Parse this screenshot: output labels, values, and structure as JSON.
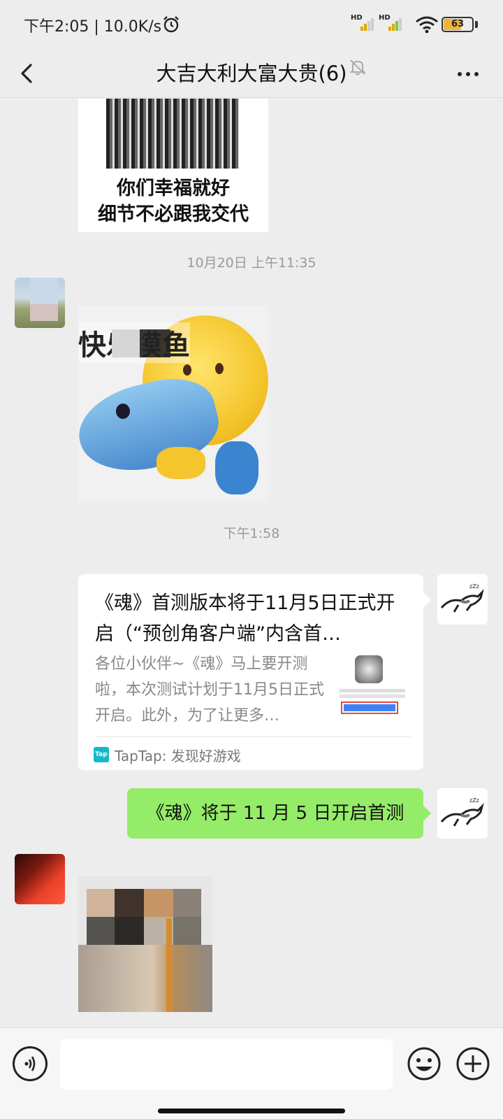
{
  "status_bar": {
    "time": "下午2:05 | 10.0K/s",
    "signal1_label": "HD",
    "signal2_label": "HD",
    "battery_level": "63",
    "battery_fraction": 0.63
  },
  "nav": {
    "title": "大吉大利大富大贵(6)",
    "back_icon": "chevron-left-icon",
    "mute_icon": "bell-muted-icon",
    "more_icon": "more-horizontal-icon"
  },
  "messages": {
    "sticker1_caption_line1": "你们幸福就好",
    "sticker1_caption_line2": "细节不必跟我交代",
    "timestamp1": "10月20日 上午11:35",
    "sticker2_caption": "快乐摸鱼",
    "timestamp2": "下午1:58",
    "link_card": {
      "title": "《魂》首测版本将于11月5日正式开启（“预创角客户端”内含首…",
      "description": "各位小伙伴~《魂》马上要开测啦，本次测试计划于11月5日正式开启。此外，为了让更多…",
      "source_icon_text": "Tap",
      "source": "TapTap: 发现好游戏"
    },
    "outgoing_text": "《魂》将于 11 月 5 日开启首测"
  },
  "input_bar": {
    "voice_icon": "voice-icon",
    "input_value": "",
    "emoji_icon": "emoji-icon",
    "plus_icon": "plus-circle-icon"
  },
  "colors": {
    "background": "#ededed",
    "outgoing_bubble": "#95ec69",
    "incoming_bubble": "#ffffff",
    "battery": "#f0b33c"
  }
}
